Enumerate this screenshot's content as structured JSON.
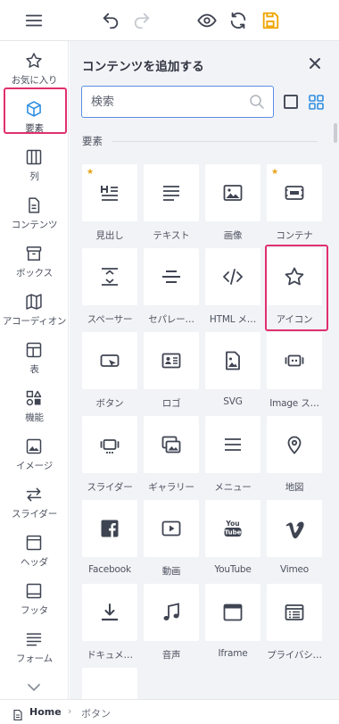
{
  "toolbar": {
    "menu_icon": "hamburger-menu-icon",
    "undo_icon": "undo-icon",
    "redo_icon": "redo-icon",
    "preview_icon": "eye-icon",
    "refresh_icon": "refresh-icon",
    "save_icon": "save-icon",
    "save_color": "#f0a500"
  },
  "sidebar": {
    "items": [
      {
        "label": "お気に入り",
        "icon": "star-icon"
      },
      {
        "label": "要素",
        "icon": "cube-icon",
        "active": true
      },
      {
        "label": "列",
        "icon": "columns-icon"
      },
      {
        "label": "コンテンツ",
        "icon": "document-icon"
      },
      {
        "label": "ボックス",
        "icon": "box-icon"
      },
      {
        "label": "アコーディオン",
        "icon": "accordion-icon"
      },
      {
        "label": "表",
        "icon": "table-icon"
      },
      {
        "label": "機能",
        "icon": "shapes-icon"
      },
      {
        "label": "イメージ",
        "icon": "image-icon"
      },
      {
        "label": "スライダー",
        "icon": "arrows-icon"
      },
      {
        "label": "ヘッダ",
        "icon": "header-icon"
      },
      {
        "label": "フッタ",
        "icon": "footer-icon"
      },
      {
        "label": "フォーム",
        "icon": "form-icon"
      }
    ],
    "more_icon": "chevron-down-icon",
    "accent_color": "#2f8ee0",
    "highlight_color": "#e0306e"
  },
  "panel": {
    "title": "コンテンツを追加する",
    "close_icon": "close-icon",
    "search_placeholder": "検索",
    "search_icon": "search-icon",
    "section_label": "要素",
    "tiles": [
      {
        "label": "見出し",
        "icon": "heading-icon",
        "starred": true
      },
      {
        "label": "テキスト",
        "icon": "text-icon",
        "starred": false
      },
      {
        "label": "画像",
        "icon": "image-icon",
        "starred": false
      },
      {
        "label": "コンテナ",
        "icon": "container-icon",
        "starred": true
      },
      {
        "label": "スペーサー",
        "icon": "spacer-icon",
        "starred": false
      },
      {
        "label": "セパレー…",
        "icon": "separator-icon",
        "starred": false
      },
      {
        "label": "HTML メ…",
        "icon": "code-icon",
        "starred": false
      },
      {
        "label": "アイコン",
        "icon": "star-outline-icon",
        "starred": false,
        "highlighted": true
      },
      {
        "label": "ボタン",
        "icon": "button-icon",
        "starred": false
      },
      {
        "label": "ロゴ",
        "icon": "logo-icon",
        "starred": false
      },
      {
        "label": "SVG",
        "icon": "svg-icon",
        "starred": false
      },
      {
        "label": "Image ス…",
        "icon": "image-slider-icon",
        "starred": false
      },
      {
        "label": "スライダー",
        "icon": "slider-icon",
        "starred": false
      },
      {
        "label": "ギャラリー",
        "icon": "gallery-icon",
        "starred": false
      },
      {
        "label": "メニュー",
        "icon": "menu-icon",
        "starred": false
      },
      {
        "label": "地図",
        "icon": "map-pin-icon",
        "starred": false
      },
      {
        "label": "Facebook",
        "icon": "facebook-icon",
        "starred": false
      },
      {
        "label": "動画",
        "icon": "video-icon",
        "starred": false
      },
      {
        "label": "YouTube",
        "icon": "youtube-icon",
        "starred": false
      },
      {
        "label": "Vimeo",
        "icon": "vimeo-icon",
        "starred": false
      },
      {
        "label": "ドキュメ…",
        "icon": "download-icon",
        "starred": false
      },
      {
        "label": "音声",
        "icon": "music-icon",
        "starred": false
      },
      {
        "label": "Iframe",
        "icon": "iframe-icon",
        "starred": false
      },
      {
        "label": "プライバシ…",
        "icon": "privacy-icon",
        "starred": false
      },
      {
        "label": "",
        "icon": "partial-tile",
        "starred": false
      }
    ]
  },
  "statusbar": {
    "home": "Home",
    "separator": "›",
    "current": "ボタン"
  }
}
